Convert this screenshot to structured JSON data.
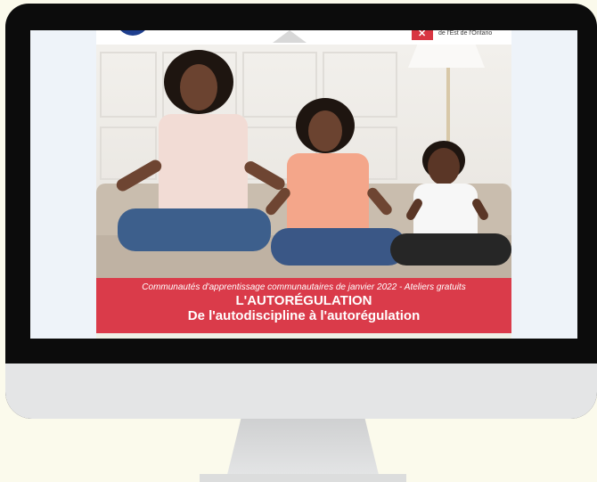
{
  "banner": {
    "org_text": "de l'Est de l'Ontario",
    "subtitle": "Communautés d'apprentissage communautaires de janvier 2022 - Ateliers gratuits",
    "title": "L'AUTORÉGULATION",
    "title_sub": "De l'autodiscipline à l'autorégulation"
  },
  "colors": {
    "background": "#fbfaec",
    "monitor_frame": "#0c0c0c",
    "monitor_chin": "#e4e5e6",
    "banner_red": "#da3b4a"
  },
  "icons": {
    "left_logo": "circle-logo-icon",
    "center_logo": "triangle-logo-icon",
    "right_logo": "red-flag-logo-icon"
  }
}
